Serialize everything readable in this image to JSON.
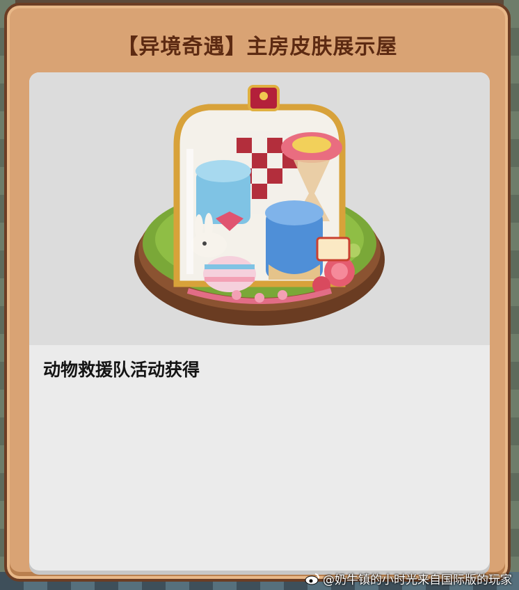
{
  "dialog": {
    "title": "【异境奇遇】主房皮肤展示屋",
    "description": "动物救援队活动获得"
  },
  "preview": {
    "icon": "skin-display-house-icon"
  },
  "watermark": {
    "text": "@奶牛镇的小时光来自国际版的玩家",
    "icon": "weibo-icon"
  },
  "colors": {
    "panel": "#d9a374",
    "panel_border": "#6b3d24",
    "title": "#5c2a12",
    "inner_bg": "#ebebeb",
    "display_bg": "#dcdcdc"
  }
}
